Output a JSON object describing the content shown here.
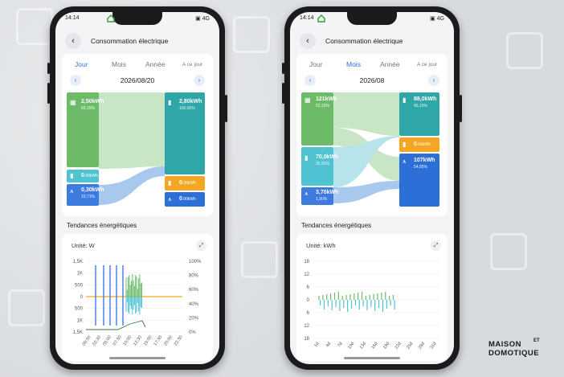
{
  "left": {
    "status": {
      "time": "14:14",
      "icons": "▣ 4G"
    },
    "title": "Consommation électrique",
    "tabs": [
      "Jour",
      "Mois",
      "Année",
      "A ce jour"
    ],
    "active_tab": 0,
    "date": "2026/08/20",
    "sankey": {
      "src_solar": {
        "value": "2,50kWh",
        "pct": "89,29%"
      },
      "src_battery": {
        "value": "0",
        "unit": ".00kWh"
      },
      "src_grid": {
        "value": "0,30kWh",
        "pct": "10,71%"
      },
      "dst_home": {
        "value": "2,80kWh",
        "pct": "100,00%"
      },
      "dst_battery": {
        "value": "0",
        "unit": ".00kWh"
      },
      "dst_grid": {
        "value": "0",
        "unit": ".00kWh"
      }
    },
    "section": "Tendances énergétiques",
    "unit": "Unité: W",
    "chart_data": {
      "type": "line",
      "ylabels_left": [
        "1,5K",
        "1K",
        "500",
        "0",
        "500",
        "1K",
        "1,5K"
      ],
      "ylabels_right": [
        "100%",
        "80%",
        "60%",
        "40%",
        "20%",
        "0%"
      ],
      "xlabels": [
        "00:00",
        "02:30",
        "05:00",
        "07:30",
        "10:00",
        "12:30",
        "15:00",
        "17:30",
        "20:00",
        "22:30"
      ]
    }
  },
  "right": {
    "status": {
      "time": "14:14",
      "icons": "▣ 4G"
    },
    "title": "Consommation électrique",
    "tabs": [
      "Jour",
      "Mois",
      "Année",
      "A ce jour"
    ],
    "active_tab": 1,
    "date": "2026/08",
    "sankey": {
      "src_solar": {
        "value": "121kWh",
        "pct": "62,19%"
      },
      "src_battery": {
        "value": "70,0kWh",
        "pct": "35,92%"
      },
      "src_grid": {
        "value": "3,70kWh",
        "pct": "1,90%"
      },
      "dst_home": {
        "value": "88,0kWh",
        "pct": "45,15%"
      },
      "dst_battery": {
        "value": "0",
        "unit": ".00kWh"
      },
      "dst_grid": {
        "value": "107kWh",
        "pct": "54,85%"
      }
    },
    "section": "Tendances énergétiques",
    "unit": "Unité: kWh",
    "chart_data": {
      "type": "bar",
      "ylabels": [
        "18",
        "12",
        "6",
        "0",
        "6",
        "12",
        "18"
      ],
      "xlabels": [
        "1d",
        "4d",
        "7d",
        "10d",
        "13d",
        "16d",
        "19d",
        "22d",
        "25d",
        "28d",
        "31d"
      ]
    }
  },
  "logo": {
    "line1": "MAISON",
    "line2": "DOMOTIQUE",
    "et": "ET"
  },
  "colors": {
    "blue": "#2c6fd6",
    "green": "#6dbb69",
    "teal": "#2fa6a8",
    "cyan": "#4fc3d2",
    "orange": "#f5a623",
    "gridblue": "#3d7be0"
  }
}
